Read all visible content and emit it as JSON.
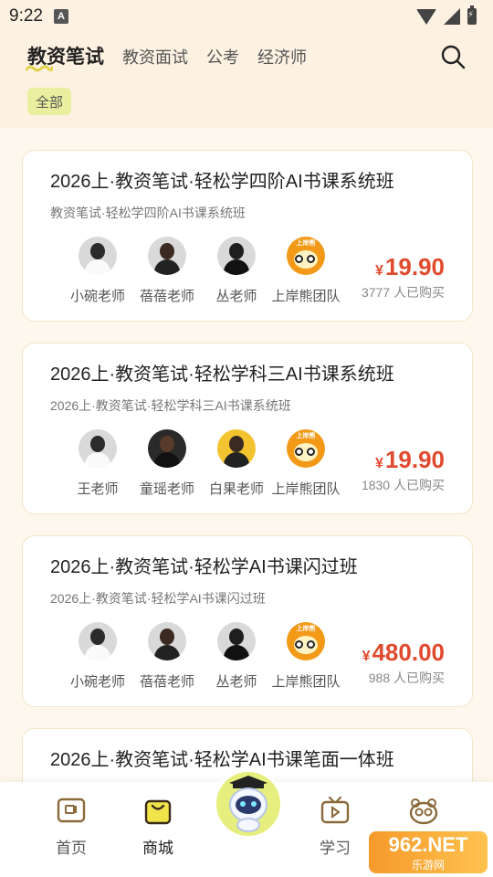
{
  "status_bar": {
    "time": "9:22",
    "notification_letter": "A"
  },
  "header": {
    "tabs": [
      {
        "label": "教资笔试",
        "active": true
      },
      {
        "label": "教资面试",
        "active": false
      },
      {
        "label": "公考",
        "active": false
      },
      {
        "label": "经济师",
        "active": false
      }
    ],
    "filter_chip": "全部",
    "accent_color": "#e04a2e"
  },
  "courses": [
    {
      "title": "2026上·教资笔试·轻松学四阶AI书课系统班",
      "subtitle": "教资笔试·轻松学四阶AI书课系统班",
      "teachers": [
        {
          "name": "小碗老师",
          "avatar": "grey-person"
        },
        {
          "name": "蓓蓓老师",
          "avatar": "grey-person"
        },
        {
          "name": "丛老师",
          "avatar": "grey-person"
        },
        {
          "name": "上岸熊团队",
          "avatar": "bear-logo",
          "badge": "上岸熊"
        }
      ],
      "currency": "¥",
      "price": "19.90",
      "buyers": "3777 人已购买"
    },
    {
      "title": "2026上·教资笔试·轻松学科三AI书课系统班",
      "subtitle": "2026上·教资笔试·轻松学科三AI书课系统班",
      "teachers": [
        {
          "name": "王老师",
          "avatar": "grey-person"
        },
        {
          "name": "童瑶老师",
          "avatar": "dark-person"
        },
        {
          "name": "白果老师",
          "avatar": "yellow-person"
        },
        {
          "name": "上岸熊团队",
          "avatar": "bear-logo",
          "badge": "上岸熊"
        }
      ],
      "currency": "¥",
      "price": "19.90",
      "buyers": "1830 人已购买"
    },
    {
      "title": "2026上·教资笔试·轻松学AI书课闪过班",
      "subtitle": "2026上·教资笔试·轻松学AI书课闪过班",
      "teachers": [
        {
          "name": "小碗老师",
          "avatar": "grey-person"
        },
        {
          "name": "蓓蓓老师",
          "avatar": "grey-person"
        },
        {
          "name": "丛老师",
          "avatar": "grey-person"
        },
        {
          "name": "上岸熊团队",
          "avatar": "bear-logo",
          "badge": "上岸熊"
        }
      ],
      "currency": "¥",
      "price": "480.00",
      "buyers": "988 人已购买"
    },
    {
      "title": "2026上·教资笔试·轻松学AI书课笔面一体班"
    }
  ],
  "bottom_nav": {
    "items": [
      {
        "label": "首页",
        "icon": "home-icon"
      },
      {
        "label": "商城",
        "icon": "shop-bag-icon",
        "active": true
      },
      {
        "label": "学习",
        "icon": "tv-study-icon"
      },
      {
        "label": "",
        "icon": "bear-face-icon"
      }
    ],
    "center_button_icon": "robot-mascot-icon"
  },
  "watermark": {
    "main": "962.NET",
    "sub": "乐游网"
  }
}
